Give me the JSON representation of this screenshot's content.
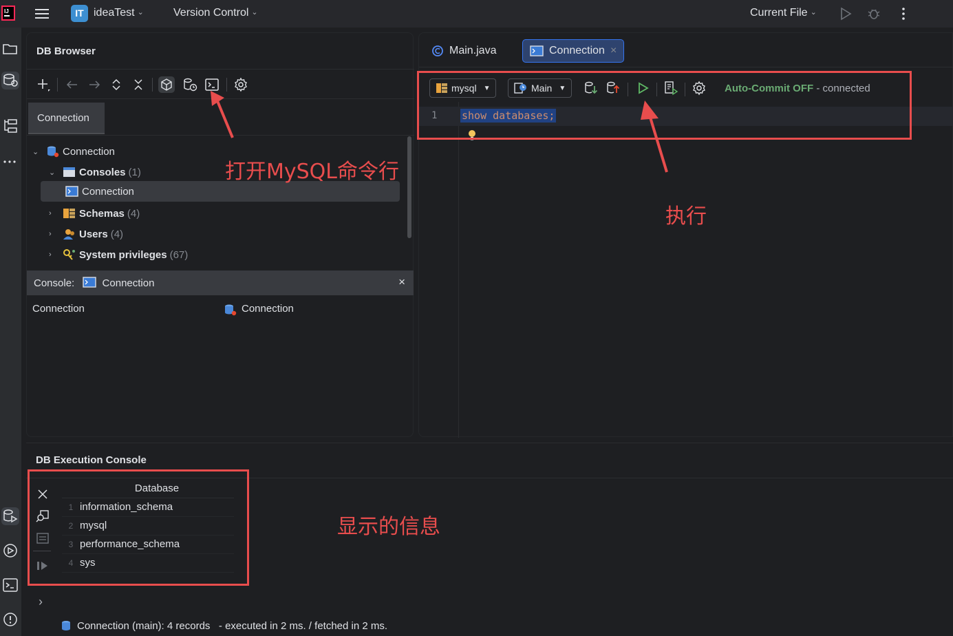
{
  "titlebar": {
    "project_badge": "IT",
    "project_name": "ideaTest",
    "version_control": "Version Control",
    "current_file": "Current File"
  },
  "db_browser": {
    "title": "DB Browser",
    "tab_label": "Connection",
    "tree": {
      "root": "Connection",
      "consoles_label": "Consoles",
      "consoles_count": "(1)",
      "console_item": "Connection",
      "schemas_label": "Schemas",
      "schemas_count": "(4)",
      "users_label": "Users",
      "users_count": "(4)",
      "privileges_label": "System privileges",
      "privileges_count": "(67)"
    },
    "console_header_label": "Console:",
    "console_header_name": "Connection",
    "console_close": "×",
    "property_name": "Connection",
    "property_value": "Connection"
  },
  "editor": {
    "tabs": [
      {
        "label": "Main.java"
      },
      {
        "label": "Connection",
        "close": "×"
      }
    ],
    "schema_dropdown": "mysql",
    "session_dropdown": "Main",
    "auto_commit": "Auto-Commit OFF",
    "connected": "- connected",
    "line_number": "1",
    "code": "show databases;"
  },
  "exec_console": {
    "title": "DB Execution Console",
    "column_header": "Database",
    "rows": [
      {
        "n": "1",
        "value": "information_schema"
      },
      {
        "n": "2",
        "value": "mysql"
      },
      {
        "n": "3",
        "value": "performance_schema"
      },
      {
        "n": "4",
        "value": "sys"
      }
    ],
    "expand_arrow": "›",
    "status": "Connection (main): 4 records   - executed in 2 ms. / fetched in 2 ms."
  },
  "annotations": {
    "open_console": "打开MySQL命令行",
    "execute": "执行",
    "info_shown": "显示的信息"
  },
  "colors": {
    "annotation_red": "#e84d4d",
    "accent_blue": "#3574f0",
    "green": "#6aab73",
    "background": "#1e1f22"
  }
}
